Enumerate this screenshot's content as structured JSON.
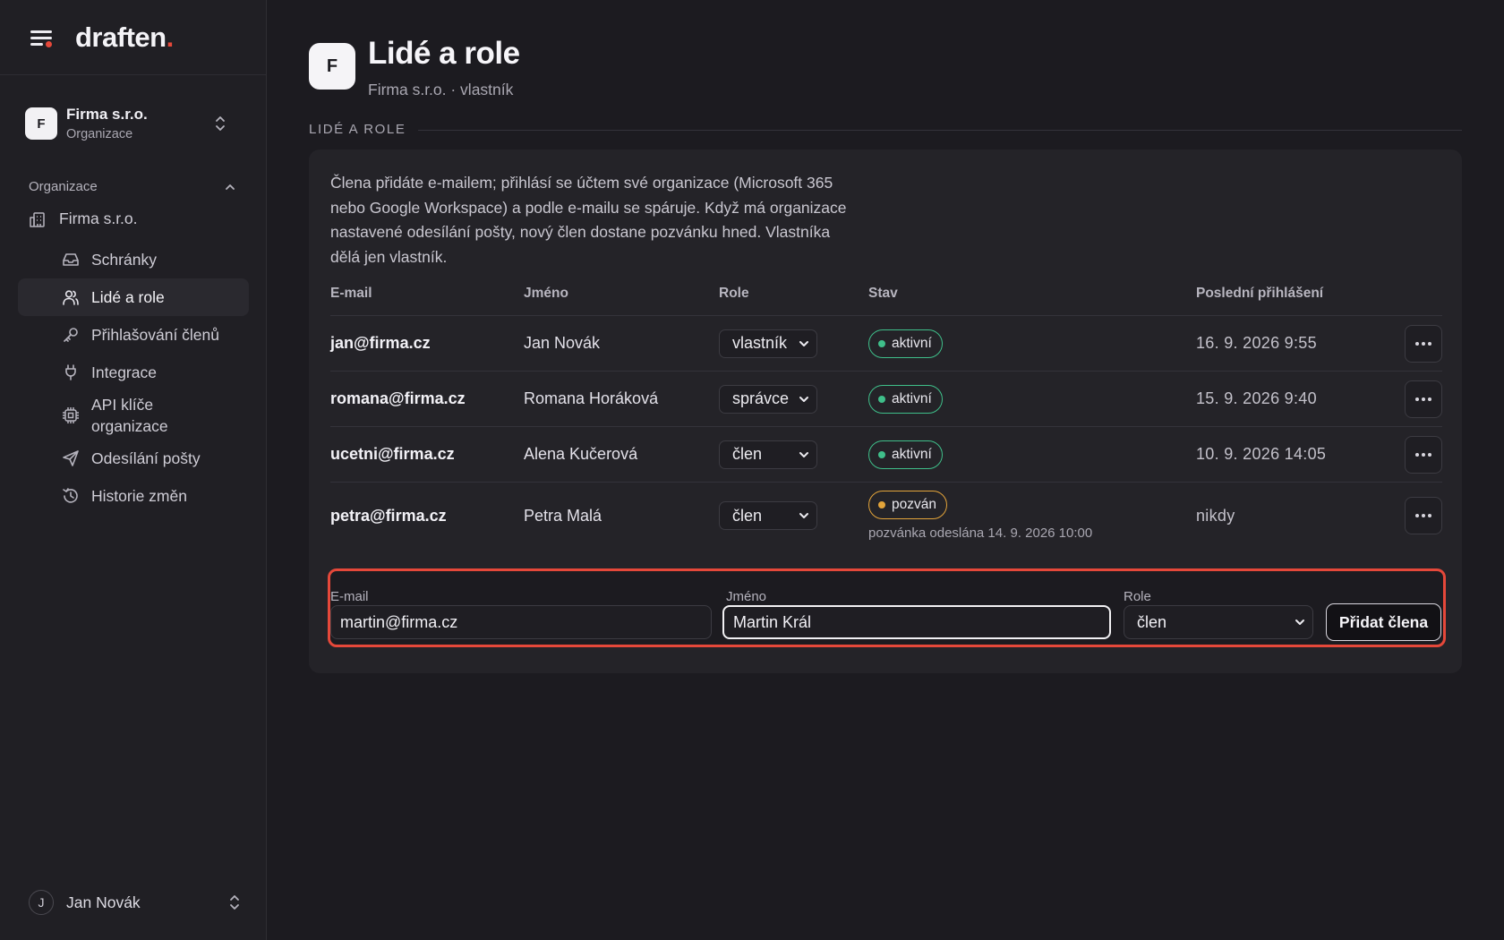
{
  "brand": {
    "name": "draften",
    "dot": "."
  },
  "org_switcher": {
    "initial": "F",
    "name": "Firma s.r.o.",
    "subtitle": "Organizace"
  },
  "sidebar": {
    "section_title": "Organizace",
    "org_item": "Firma s.r.o.",
    "items": [
      {
        "label": "Schránky",
        "icon": "inbox-icon"
      },
      {
        "label": "Lidé a role",
        "icon": "users-icon",
        "active": true
      },
      {
        "label": "Přihlašování členů",
        "icon": "key-icon"
      },
      {
        "label": "Integrace",
        "icon": "plug-icon"
      },
      {
        "label": "API klíče organizace",
        "icon": "chip-icon"
      },
      {
        "label": "Odesílání pošty",
        "icon": "send-icon"
      },
      {
        "label": "Historie změn",
        "icon": "history-icon"
      }
    ]
  },
  "user": {
    "initial": "J",
    "name": "Jan Novák"
  },
  "page": {
    "initial": "F",
    "title": "Lidé a role",
    "subtitle": "Firma s.r.o. · vlastník",
    "section_label": "LIDÉ A ROLE",
    "intro": "Člena přidáte e-mailem; přihlásí se účtem své organizace (Microsoft 365 nebo Google Workspace) a podle e-mailu se spáruje. Když má organizace nastavené odesílání pošty, nový člen dostane pozvánku hned. Vlastníka dělá jen vlastník."
  },
  "table": {
    "headers": {
      "email": "E-mail",
      "name": "Jméno",
      "role": "Role",
      "state": "Stav",
      "last_login": "Poslední přihlášení"
    },
    "rows": [
      {
        "email": "jan@firma.cz",
        "name": "Jan Novák",
        "role": "vlastník",
        "state": "aktivní",
        "state_color": "#3fbf8a",
        "last_login": "16. 9. 2026 9:55"
      },
      {
        "email": "romana@firma.cz",
        "name": "Romana Horáková",
        "role": "správce",
        "state": "aktivní",
        "state_color": "#3fbf8a",
        "last_login": "15. 9. 2026 9:40"
      },
      {
        "email": "ucetni@firma.cz",
        "name": "Alena Kučerová",
        "role": "člen",
        "state": "aktivní",
        "state_color": "#3fbf8a",
        "last_login": "10. 9. 2026 14:05"
      },
      {
        "email": "petra@firma.cz",
        "name": "Petra Malá",
        "role": "člen",
        "state": "pozván",
        "state_color": "#e3a43a",
        "state_note": "pozvánka odeslána 14. 9. 2026 10:00",
        "last_login": "nikdy"
      }
    ]
  },
  "add_form": {
    "email_label": "E-mail",
    "email_value": "martin@firma.cz",
    "name_label": "Jméno",
    "name_value": "Martin Král",
    "role_label": "Role",
    "role_value": "člen",
    "submit_label": "Přidat člena",
    "highlight_color": "#e5483a"
  }
}
